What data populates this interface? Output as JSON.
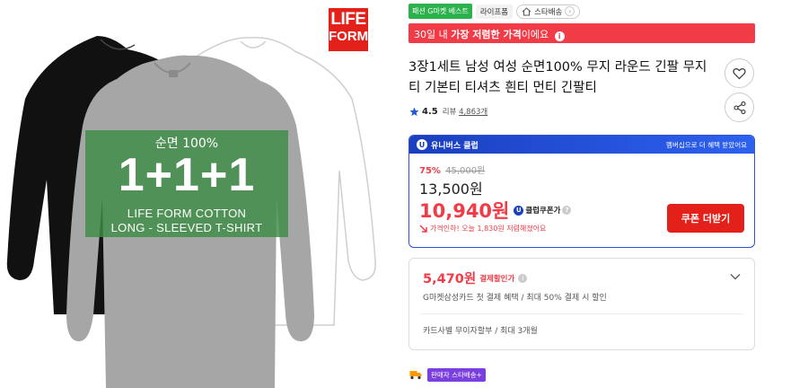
{
  "product_image": {
    "logo_line1": "LIFE",
    "logo_line2": "FORM",
    "promo_line1": "순면 100%",
    "promo_big": "1+1+1",
    "promo_line3": "LIFE FORM COTTON",
    "promo_line4": "LONG - SLEEVED T-SHIRT"
  },
  "badges": {
    "best": "패션 G마켓 베스트",
    "store": "라이프폼",
    "shipping": "스타배송"
  },
  "low_price_banner": {
    "prefix": "30일 내 ",
    "highlight": "가장 저렴한 가격",
    "suffix": "이에요",
    "info_icon": "i"
  },
  "title": "3장1세트 남성 여성 순면100% 무지 라운드 긴팔 무지티 기본티 티셔츠 흰티 먼티 긴팔티",
  "rating": {
    "score": "4.5",
    "review_label": "리뷰",
    "review_count": "4,863개"
  },
  "price_box": {
    "header_title": "유니버스 클럽",
    "header_right": "멤버십으로 더 혜택 받았어요",
    "discount_rate": "75%",
    "original_price": "45,000원",
    "sale_price": "13,500원",
    "coupon_price": "10,940원",
    "coupon_label": "클럽쿠폰가",
    "price_drop": "가격인하! 오늘 1,830원 저렴해졌어요",
    "coupon_button": "쿠폰 더받기"
  },
  "payment": {
    "amount": "5,470원",
    "label": "결제할인가",
    "desc": "G마켓삼성카드 첫 결제 혜택 / 최대 50% 결제 시 할인",
    "installment": "카드사별 무이자할부 / 최대 3개월"
  },
  "delivery": {
    "badge": "판매자 스타배송+"
  },
  "colors": {
    "accent_red": "#f13c48",
    "club_blue": "#1a3fbf",
    "brand_red": "#e4201b"
  }
}
